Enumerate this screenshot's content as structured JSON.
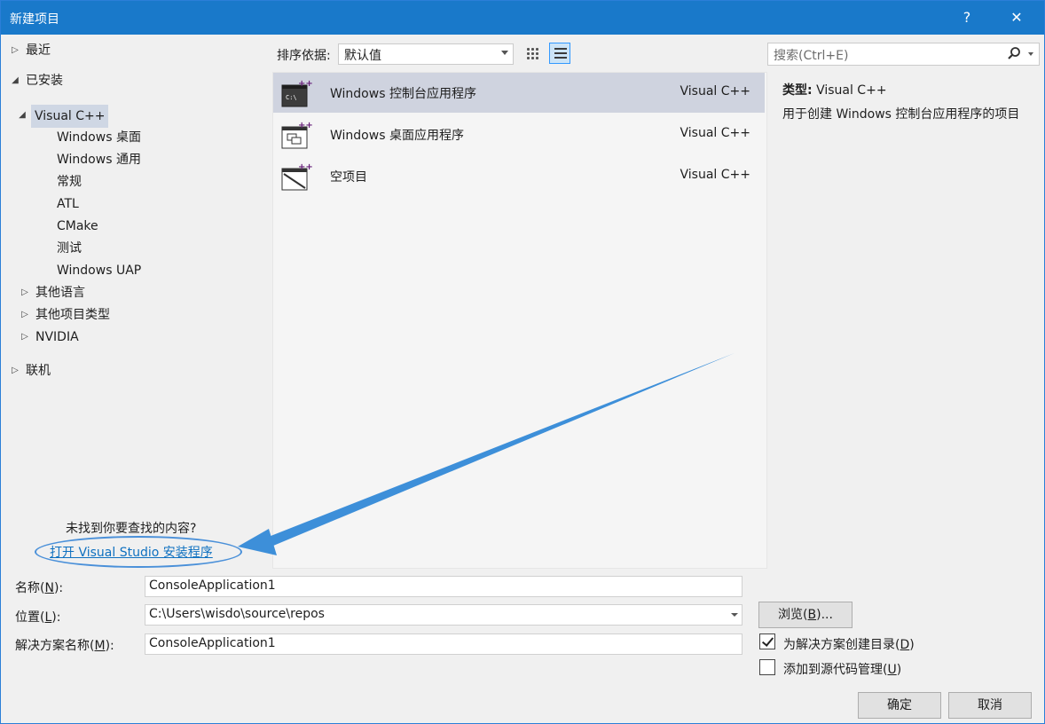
{
  "window": {
    "title": "新建项目",
    "help": "?",
    "close": "✕"
  },
  "tree": {
    "recent": "最近",
    "installed": "已安装",
    "visual_cpp": "Visual C++",
    "cpp_children": [
      "Windows 桌面",
      "Windows 通用",
      "常规",
      "ATL",
      "CMake",
      "测试",
      "Windows UAP"
    ],
    "other_languages": "其他语言",
    "other_project_types": "其他项目类型",
    "nvidia": "NVIDIA",
    "online": "联机"
  },
  "not_found": {
    "question": "未找到你要查找的内容?",
    "link": "打开 Visual Studio 安装程序"
  },
  "sort": {
    "label": "排序依据:",
    "value": "默认值"
  },
  "templates": [
    {
      "name": "Windows 控制台应用程序",
      "lang": "Visual C++",
      "selected": true,
      "icon": "console-app-icon"
    },
    {
      "name": "Windows 桌面应用程序",
      "lang": "Visual C++",
      "selected": false,
      "icon": "desktop-app-icon"
    },
    {
      "name": "空项目",
      "lang": "Visual C++",
      "selected": false,
      "icon": "empty-project-icon"
    }
  ],
  "search": {
    "placeholder": "搜索(Ctrl+E)"
  },
  "details": {
    "type_label": "类型:",
    "type_value": "Visual C++",
    "description": "用于创建 Windows 控制台应用程序的项目"
  },
  "form": {
    "name_label_pre": "名称(",
    "name_label_key": "N",
    "name_label_post": "):",
    "name_value": "ConsoleApplication1",
    "location_label_pre": "位置(",
    "location_label_key": "L",
    "location_label_post": "):",
    "location_value": "C:\\Users\\wisdo\\source\\repos",
    "solution_label_pre": "解决方案名称(",
    "solution_label_key": "M",
    "solution_label_post": "):",
    "solution_value": "ConsoleApplication1",
    "browse_pre": "浏览(",
    "browse_key": "B",
    "browse_post": ")...",
    "create_dir_pre": "为解决方案创建目录(",
    "create_dir_key": "D",
    "create_dir_post": ")",
    "create_dir_checked": true,
    "source_control_pre": "添加到源代码管理(",
    "source_control_key": "U",
    "source_control_post": ")",
    "source_control_checked": false
  },
  "buttons": {
    "ok": "确定",
    "cancel": "取消"
  },
  "colors": {
    "titlebar": "#1979ca",
    "selection": "#cfd3df",
    "link": "#0e70c0",
    "annotation": "#4a90d9"
  }
}
